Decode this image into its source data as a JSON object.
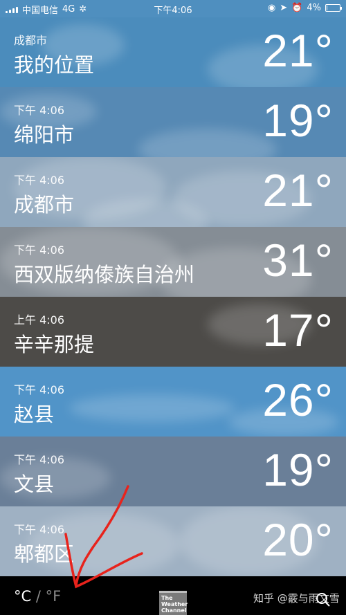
{
  "status_bar": {
    "carrier": "中国电信",
    "network": "4G",
    "time": "下午4:06",
    "battery": "4%",
    "battery_level": 0.04
  },
  "cities": [
    {
      "sub": "成都市",
      "name": "我的位置",
      "temp": "21°",
      "bg": "#4b8cbc"
    },
    {
      "sub": "下午 4:06",
      "name": "绵阳市",
      "temp": "19°",
      "bg": "#5689b4"
    },
    {
      "sub": "下午 4:06",
      "name": "成都市",
      "temp": "21°",
      "bg": "#8fa7bd"
    },
    {
      "sub": "下午 4:06",
      "name": "西双版纳傣族自治州",
      "temp": "31°",
      "bg": "#858d95"
    },
    {
      "sub": "上午 4:06",
      "name": "辛辛那提",
      "temp": "17°",
      "bg": "#4d4b48"
    },
    {
      "sub": "下午 4:06",
      "name": "赵县",
      "temp": "26°",
      "bg": "#5194c8"
    },
    {
      "sub": "下午 4:06",
      "name": "文县",
      "temp": "19°",
      "bg": "#6a7f98"
    },
    {
      "sub": "下午 4:06",
      "name": "郫都区",
      "temp": "20°",
      "bg": "#9fb1c3"
    }
  ],
  "bottom_bar": {
    "unit_c": "°C",
    "unit_sep": " / ",
    "unit_f": "°F",
    "logo_text": "The Weather Channel",
    "watermark": "知乎 @霰与雨文雪"
  }
}
